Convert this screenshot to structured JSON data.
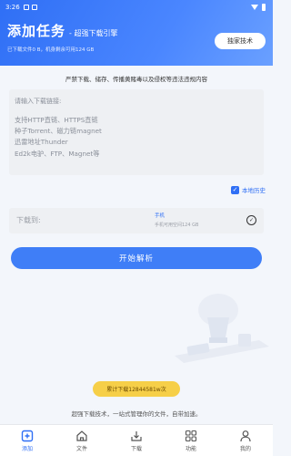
{
  "status_bar": {
    "time": "3:26"
  },
  "header": {
    "title": "添加任务",
    "subtitle": "- 超强下载引擎",
    "storage_text": "已下载文件0 B，机身剩余可用124 GB",
    "tech_button": "独家技术"
  },
  "notice": "严禁下载、储存、传播黄赌毒以及侵权等违法违规内容",
  "link_input": {
    "placeholder": "请输入下载链接:",
    "hint_lines": [
      "支持HTTP直链、HTTPS直链",
      "种子Torrent、磁力链magnet",
      "迅雷地址Thunder",
      "Ed2k电驴、FTP、Magnet等"
    ]
  },
  "history": {
    "label": "本地历史",
    "checked": true
  },
  "download_to": {
    "label": "下载到:",
    "location": "手机",
    "available": "手机可用空间124 GB"
  },
  "start_button": "开始解析",
  "count_badge": "累计下载12844581w次",
  "slogan": "超强下载技术，一站式管理你的文件，自带加速。",
  "tabs": [
    {
      "label": "添加",
      "icon": "add-icon",
      "active": true
    },
    {
      "label": "文件",
      "icon": "home-icon",
      "active": false
    },
    {
      "label": "下载",
      "icon": "download-icon",
      "active": false
    },
    {
      "label": "功能",
      "icon": "grid-icon",
      "active": false
    },
    {
      "label": "我的",
      "icon": "user-icon",
      "active": false
    }
  ],
  "colors": {
    "primary": "#2f6ff5",
    "badge": "#f6cf48"
  }
}
